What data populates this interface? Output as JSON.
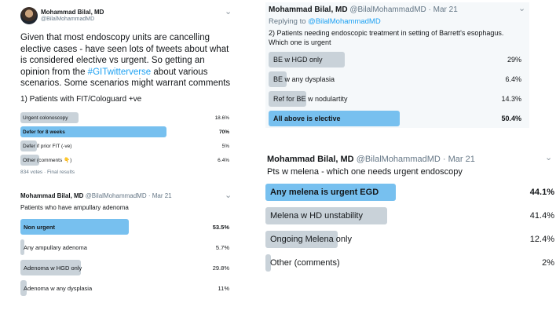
{
  "tweet1": {
    "author": "Mohammad Bilal, MD",
    "handle": "@BilalMohammadMD",
    "body_before_link": "Given that most endoscopy units are cancelling elective cases - have seen lots of tweets about what is considered elective vs urgent. So getting an opinion from the ",
    "hashtag": "#GITwitterverse",
    "body_after_link": " about various scenarios. Some scenarios might warrant comments",
    "question": "1) Patients with FIT/Cologuard +ve",
    "options": [
      {
        "label": "Urgent colonoscopy",
        "pct": "18.6%",
        "fraction": 0.186
      },
      {
        "label": "Defer for 8 weeks",
        "pct": "70%",
        "fraction": 0.7,
        "winner": true
      },
      {
        "label": "Defer if prior FIT (-ve)",
        "pct": "5%",
        "fraction": 0.05
      },
      {
        "label": "Other (comments 👇)",
        "pct": "6.4%",
        "fraction": 0.064
      }
    ],
    "footer": "834 votes · Final results"
  },
  "tweet2": {
    "author": "Mohammad Bilal, MD",
    "handle": "@BilalMohammadMD",
    "date": "Mar 21",
    "question": "Patients who have ampullary adenoma",
    "options": [
      {
        "label": "Non urgent",
        "pct": "53.5%",
        "fraction": 0.535,
        "winner": true
      },
      {
        "label": "Any ampullary adenoma",
        "pct": "5.7%",
        "fraction": 0.057
      },
      {
        "label": "Adenoma w HGD only",
        "pct": "29.8%",
        "fraction": 0.298
      },
      {
        "label": "Adenoma w any dysplasia",
        "pct": "11%",
        "fraction": 0.11
      }
    ]
  },
  "tweet3": {
    "author": "Mohammad Bilal, MD",
    "handle": "@BilalMohammadMD",
    "date": "Mar 21",
    "replying_prefix": "Replying to ",
    "replying_to": "@BilalMohammadMD",
    "question": "2) Patients needing endoscopic treatment in setting of Barrett's esophagus. Which one is urgent",
    "options": [
      {
        "label": "BE w HGD only",
        "pct": "29%",
        "fraction": 0.29
      },
      {
        "label": "BE w any dysplasia",
        "pct": "6.4%",
        "fraction": 0.064
      },
      {
        "label": "Ref for BE w nodulartity",
        "pct": "14.3%",
        "fraction": 0.143
      },
      {
        "label": "All above is elective",
        "pct": "50.4%",
        "fraction": 0.504,
        "winner": true
      }
    ]
  },
  "tweet4": {
    "author": "Mohammad Bilal, MD",
    "handle": "@BilalMohammadMD",
    "date": "Mar 21",
    "question": "Pts w melena - which one needs urgent endoscopy",
    "options": [
      {
        "label": "Any melena is urgent EGD",
        "pct": "44.1%",
        "fraction": 0.441,
        "winner": true
      },
      {
        "label": "Melena w HD unstability",
        "pct": "41.4%",
        "fraction": 0.414
      },
      {
        "label": "Ongoing Melena only",
        "pct": "12.4%",
        "fraction": 0.124
      },
      {
        "label": "Other (comments)",
        "pct": "2%",
        "fraction": 0.02
      }
    ]
  },
  "icons": {
    "chevron": "chevron-down-icon",
    "avatar": "avatar"
  },
  "colors": {
    "winner_bar": "#77c0ef",
    "bar": "#c9d2d9",
    "link": "#1da1f2",
    "meta": "#657786"
  }
}
